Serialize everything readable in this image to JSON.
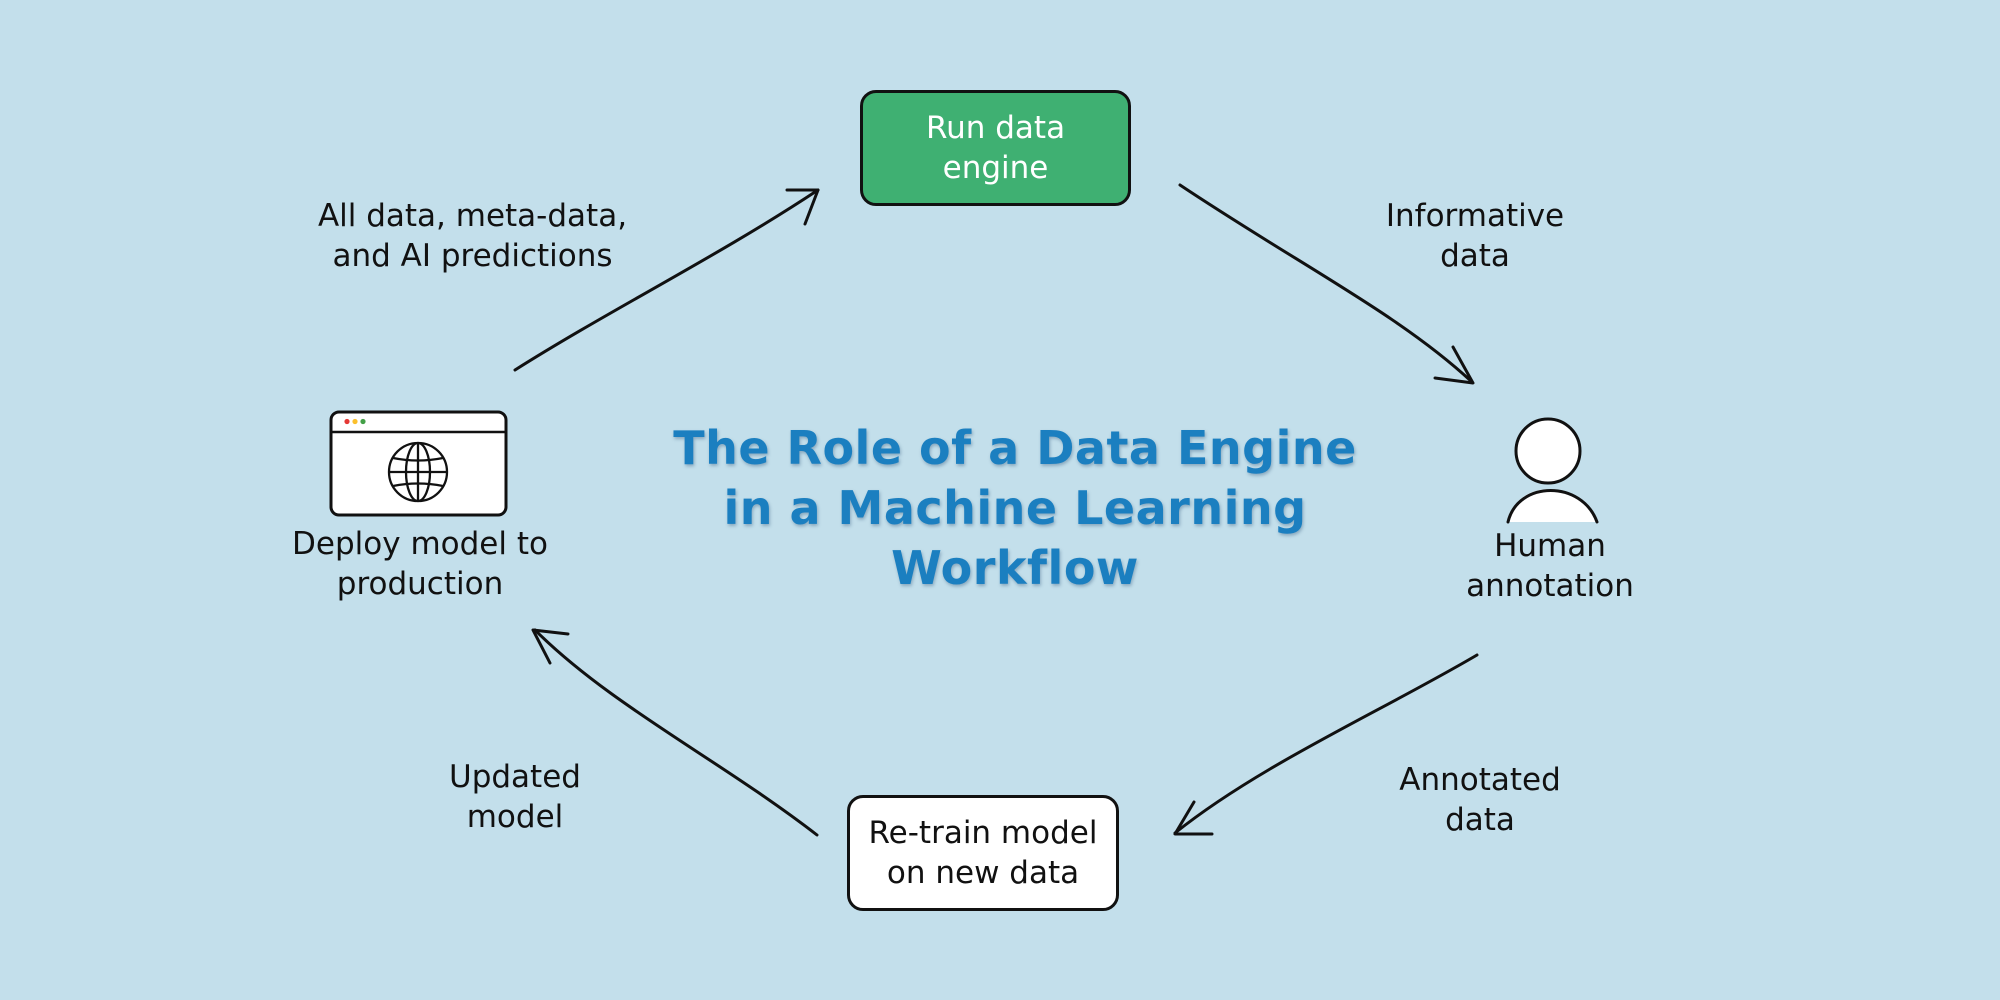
{
  "title": "The Role of a Data Engine\nin a Machine Learning\nWorkflow",
  "nodes": {
    "run_data_engine": "Run data\nengine",
    "human_annotation": "Human\nannotation",
    "retrain_model": "Re-train model\non new data",
    "deploy_model": "Deploy model to\nproduction"
  },
  "edges": {
    "run_to_annotation": "Informative\ndata",
    "annotation_to_retrain": "Annotated\ndata",
    "retrain_to_deploy": "Updated\nmodel",
    "deploy_to_run": "All data, meta-data,\nand AI predictions"
  },
  "colors": {
    "background": "#c3dfeb",
    "run_box_fill": "#3fb072",
    "title": "#1b7fc0"
  },
  "icons": {
    "deploy": "browser-globe-icon",
    "annotation": "person-icon"
  }
}
